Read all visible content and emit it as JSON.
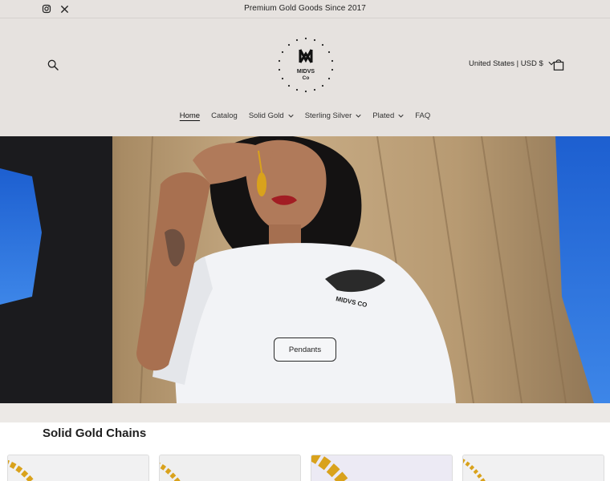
{
  "announcement": {
    "social": [
      "instagram-icon",
      "x-icon"
    ],
    "message": "Premium Gold Goods Since 2017"
  },
  "header": {
    "logo_text_line1": "MIDVS",
    "logo_text_line2": "Co",
    "locale": "United States | USD $",
    "icons": [
      "search-icon",
      "cart-icon",
      "chevron-down-icon"
    ]
  },
  "nav": {
    "items": [
      {
        "label": "Home",
        "active": true,
        "dropdown": false
      },
      {
        "label": "Catalog",
        "active": false,
        "dropdown": false
      },
      {
        "label": "Solid Gold",
        "active": false,
        "dropdown": true
      },
      {
        "label": "Sterling Silver",
        "active": false,
        "dropdown": true
      },
      {
        "label": "Plated",
        "active": false,
        "dropdown": true
      },
      {
        "label": "FAQ",
        "active": false,
        "dropdown": false
      }
    ]
  },
  "hero": {
    "button_label": "Pendants",
    "shirt_text": "MIDVS CO"
  },
  "collection": {
    "title": "Solid Gold Chains",
    "product_count_visible": 4
  },
  "colors": {
    "header_bg": "#e6e2df",
    "text": "#1f1f1f",
    "gold": "#d9a21c"
  }
}
